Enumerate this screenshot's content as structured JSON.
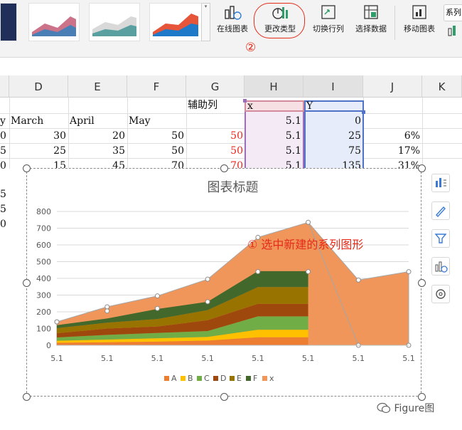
{
  "ribbon": {
    "buttons": [
      {
        "label": "在线图表",
        "has_dropdown": true
      },
      {
        "label": "更改类型",
        "highlighted": true
      },
      {
        "label": "切换行列"
      },
      {
        "label": "选择数据"
      },
      {
        "label": "移动图表"
      },
      {
        "label": "系列"
      }
    ],
    "gallery_scroll": "▾",
    "gallery_dropdown": "▾"
  },
  "annotations": {
    "step1": "① 选中新建的系列图形",
    "step2": "②",
    "color": "#e52b1a"
  },
  "columns": [
    "D",
    "E",
    "F",
    "G",
    "H",
    "I",
    "J",
    "K"
  ],
  "sheet": {
    "header_row1": {
      "g": "辅助列",
      "h": "x",
      "i": "Y"
    },
    "header_row2": {
      "c_tail": "y",
      "d": "March",
      "e": "April",
      "f": "May"
    },
    "rows": [
      {
        "c_tail": "0",
        "d": "30",
        "e": "20",
        "f": "50",
        "g": "50",
        "h": "5.1",
        "i": "25",
        "j": "6%"
      },
      {
        "c_tail": "5",
        "d": "25",
        "e": "35",
        "f": "50",
        "g": "50",
        "h": "5.1",
        "i": "75",
        "j": "17%"
      },
      {
        "c_tail": "0",
        "d": "15",
        "e": "45",
        "f": "70",
        "g": "70",
        "h": "5.1",
        "i": "135",
        "j": "31%"
      }
    ],
    "h_row1_value": "5.1",
    "i_row1_value": "0",
    "left_tails": [
      "5",
      "5",
      "0"
    ]
  },
  "chart_data": {
    "type": "area",
    "title": "图表标题",
    "categories": [
      "5.1",
      "5.1",
      "5.1",
      "5.1",
      "5.1",
      "5.1",
      "5.1",
      "5.1"
    ],
    "ylim": [
      0,
      800
    ],
    "yticks": [
      "0",
      "100",
      "200",
      "300",
      "400",
      "500",
      "600",
      "700",
      "800"
    ],
    "grid": true,
    "legend": "bottom",
    "legend_entries": [
      "A",
      "B",
      "C",
      "D",
      "E",
      "F",
      "x"
    ],
    "stacked_series": [
      {
        "name": "A",
        "color": "#ed7d31",
        "values": [
          15,
          18,
          22,
          28,
          48,
          48
        ]
      },
      {
        "name": "B",
        "color": "#ffc000",
        "values": [
          12,
          16,
          20,
          22,
          45,
          45
        ]
      },
      {
        "name": "C",
        "color": "#70ad47",
        "values": [
          20,
          28,
          32,
          35,
          80,
          80
        ]
      },
      {
        "name": "D",
        "color": "#9e480e",
        "values": [
          25,
          38,
          38,
          65,
          75,
          75
        ]
      },
      {
        "name": "E",
        "color": "#997300",
        "values": [
          30,
          35,
          45,
          60,
          100,
          100
        ]
      },
      {
        "name": "F",
        "color": "#43682b",
        "values": [
          18,
          25,
          60,
          50,
          95,
          95
        ]
      }
    ],
    "x_series": {
      "name": "x",
      "color": "#f0965a",
      "values": [
        140,
        230,
        295,
        395,
        645,
        735,
        390,
        440
      ]
    },
    "marker_points_x": [
      140,
      230,
      295,
      395,
      645,
      735,
      390,
      440
    ],
    "marker_points_x_low": [
      null,
      null,
      null,
      null,
      null,
      null,
      0,
      0
    ],
    "marker_points_stack": [
      140,
      205,
      220,
      260,
      440,
      440
    ]
  },
  "watermark": "Figure图"
}
